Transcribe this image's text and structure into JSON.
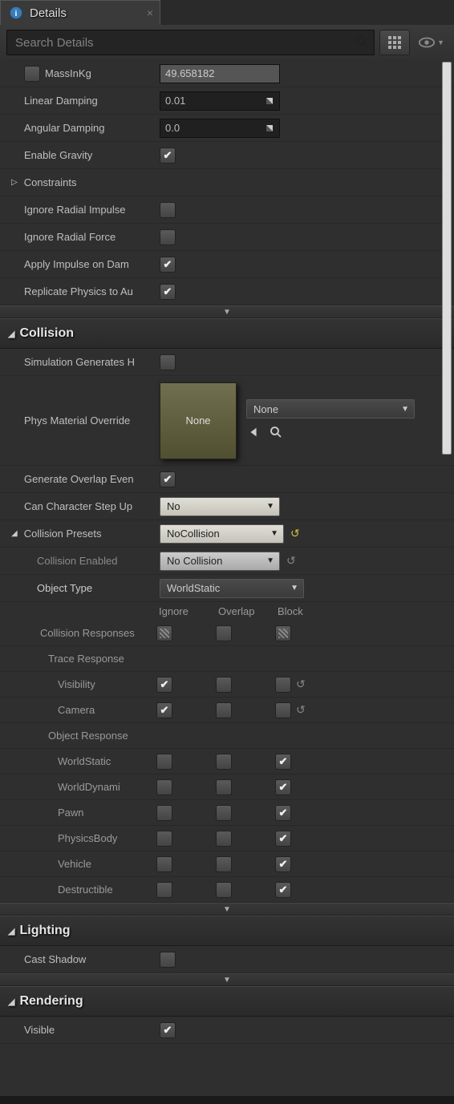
{
  "tab": {
    "title": "Details"
  },
  "search": {
    "placeholder": "Search Details"
  },
  "physics": {
    "massInKg": {
      "label": "MassInKg",
      "value": "49.658182",
      "checked": false
    },
    "linearDamping": {
      "label": "Linear Damping",
      "value": "0.01"
    },
    "angularDamping": {
      "label": "Angular Damping",
      "value": "0.0"
    },
    "enableGravity": {
      "label": "Enable Gravity",
      "checked": true
    },
    "constraints": {
      "label": "Constraints"
    },
    "ignoreRadialImpulse": {
      "label": "Ignore Radial Impulse",
      "checked": false
    },
    "ignoreRadialForce": {
      "label": "Ignore Radial Force",
      "checked": false
    },
    "applyImpulseOnDamage": {
      "label": "Apply Impulse on Dam",
      "checked": true
    },
    "replicatePhysics": {
      "label": "Replicate Physics to Au",
      "checked": true
    }
  },
  "collision": {
    "header": "Collision",
    "simGenHits": {
      "label": "Simulation Generates H",
      "checked": false
    },
    "physMatOverride": {
      "label": "Phys Material Override",
      "thumbText": "None",
      "dropdown": "None"
    },
    "genOverlap": {
      "label": "Generate Overlap Even",
      "checked": true
    },
    "canStepUp": {
      "label": "Can Character Step Up",
      "value": "No"
    },
    "presets": {
      "label": "Collision Presets",
      "value": "NoCollision"
    },
    "collisionEnabled": {
      "label": "Collision Enabled",
      "value": "No Collision"
    },
    "objectType": {
      "label": "Object Type",
      "value": "WorldStatic"
    },
    "responsesLabel": "Collision Responses",
    "headers": {
      "ignore": "Ignore",
      "overlap": "Overlap",
      "block": "Block"
    },
    "traceHeader": "Trace Response",
    "objectHeader": "Object Response",
    "responses": [
      {
        "name": "Visibility",
        "ignore": true,
        "overlap": false,
        "block": false,
        "reset": true
      },
      {
        "name": "Camera",
        "ignore": true,
        "overlap": false,
        "block": false,
        "reset": true
      },
      {
        "name": "WorldStatic",
        "ignore": false,
        "overlap": false,
        "block": true
      },
      {
        "name": "WorldDynami",
        "ignore": false,
        "overlap": false,
        "block": true
      },
      {
        "name": "Pawn",
        "ignore": false,
        "overlap": false,
        "block": true
      },
      {
        "name": "PhysicsBody",
        "ignore": false,
        "overlap": false,
        "block": true
      },
      {
        "name": "Vehicle",
        "ignore": false,
        "overlap": false,
        "block": true
      },
      {
        "name": "Destructible",
        "ignore": false,
        "overlap": false,
        "block": true
      }
    ]
  },
  "lighting": {
    "header": "Lighting",
    "castShadow": {
      "label": "Cast Shadow",
      "checked": false
    }
  },
  "rendering": {
    "header": "Rendering",
    "visible": {
      "label": "Visible",
      "checked": true
    }
  }
}
